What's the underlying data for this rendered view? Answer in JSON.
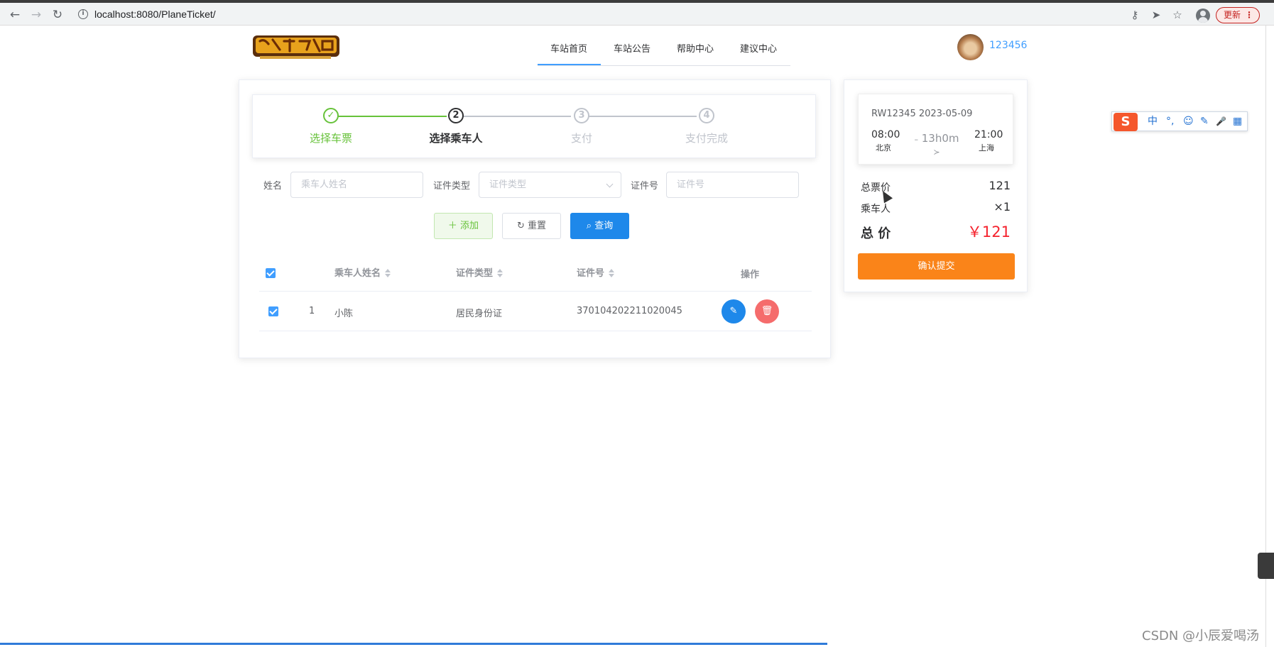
{
  "browser": {
    "url": "localhost:8080/PlaneTicket/",
    "update_label": "更新",
    "update_menu": "⋮",
    "info_icon": "i"
  },
  "header": {
    "nav": [
      "车站首页",
      "车站公告",
      "帮助中心",
      "建议中心"
    ],
    "active_nav": 0,
    "username": "123456"
  },
  "steps": [
    {
      "label": "选择车票",
      "number": "✓",
      "status": "finish"
    },
    {
      "label": "选择乘车人",
      "number": "2",
      "status": "process"
    },
    {
      "label": "支付",
      "number": "3",
      "status": "wait"
    },
    {
      "label": "支付完成",
      "number": "4",
      "status": "wait"
    }
  ],
  "search": {
    "name_label": "姓名",
    "name_placeholder": "乘车人姓名",
    "type_label": "证件类型",
    "type_placeholder": "证件类型",
    "id_label": "证件号",
    "id_placeholder": "证件号",
    "add_label": "＋ 添加",
    "reset_label": "↻ 重置",
    "query_label": "⌕ 查询"
  },
  "table": {
    "columns": [
      "乘车人姓名",
      "证件类型",
      "证件号",
      "操作"
    ],
    "rows": [
      {
        "index": "1",
        "name": "小陈",
        "id_type": "居民身份证",
        "id_number": "370104202211020045",
        "checked": true
      }
    ],
    "edit_icon": "✎",
    "delete_icon": "🗑"
  },
  "ticket": {
    "title": "RW12345 2023-05-09",
    "depart_time": "08:00",
    "depart_city": "北京",
    "duration": "13h0m",
    "arrive_time": "21:00",
    "arrive_city": "上海"
  },
  "summary": {
    "fare_label": "总票价",
    "fare_value": "121",
    "passenger_label": "乘车人",
    "passenger_value": "×1",
    "total_label": "总 价",
    "total_value": "￥121",
    "submit_label": "确认提交"
  },
  "ime": {
    "logo": "S",
    "items": [
      "中",
      "°,",
      "☺",
      "✎",
      "🎤",
      "▦"
    ]
  },
  "watermark": "CSDN @小辰爱喝汤",
  "colors": {
    "primary": "#409eff",
    "success": "#67c23a",
    "danger": "#f56c6c",
    "submit": "#fa8419",
    "price": "#f5222d"
  }
}
